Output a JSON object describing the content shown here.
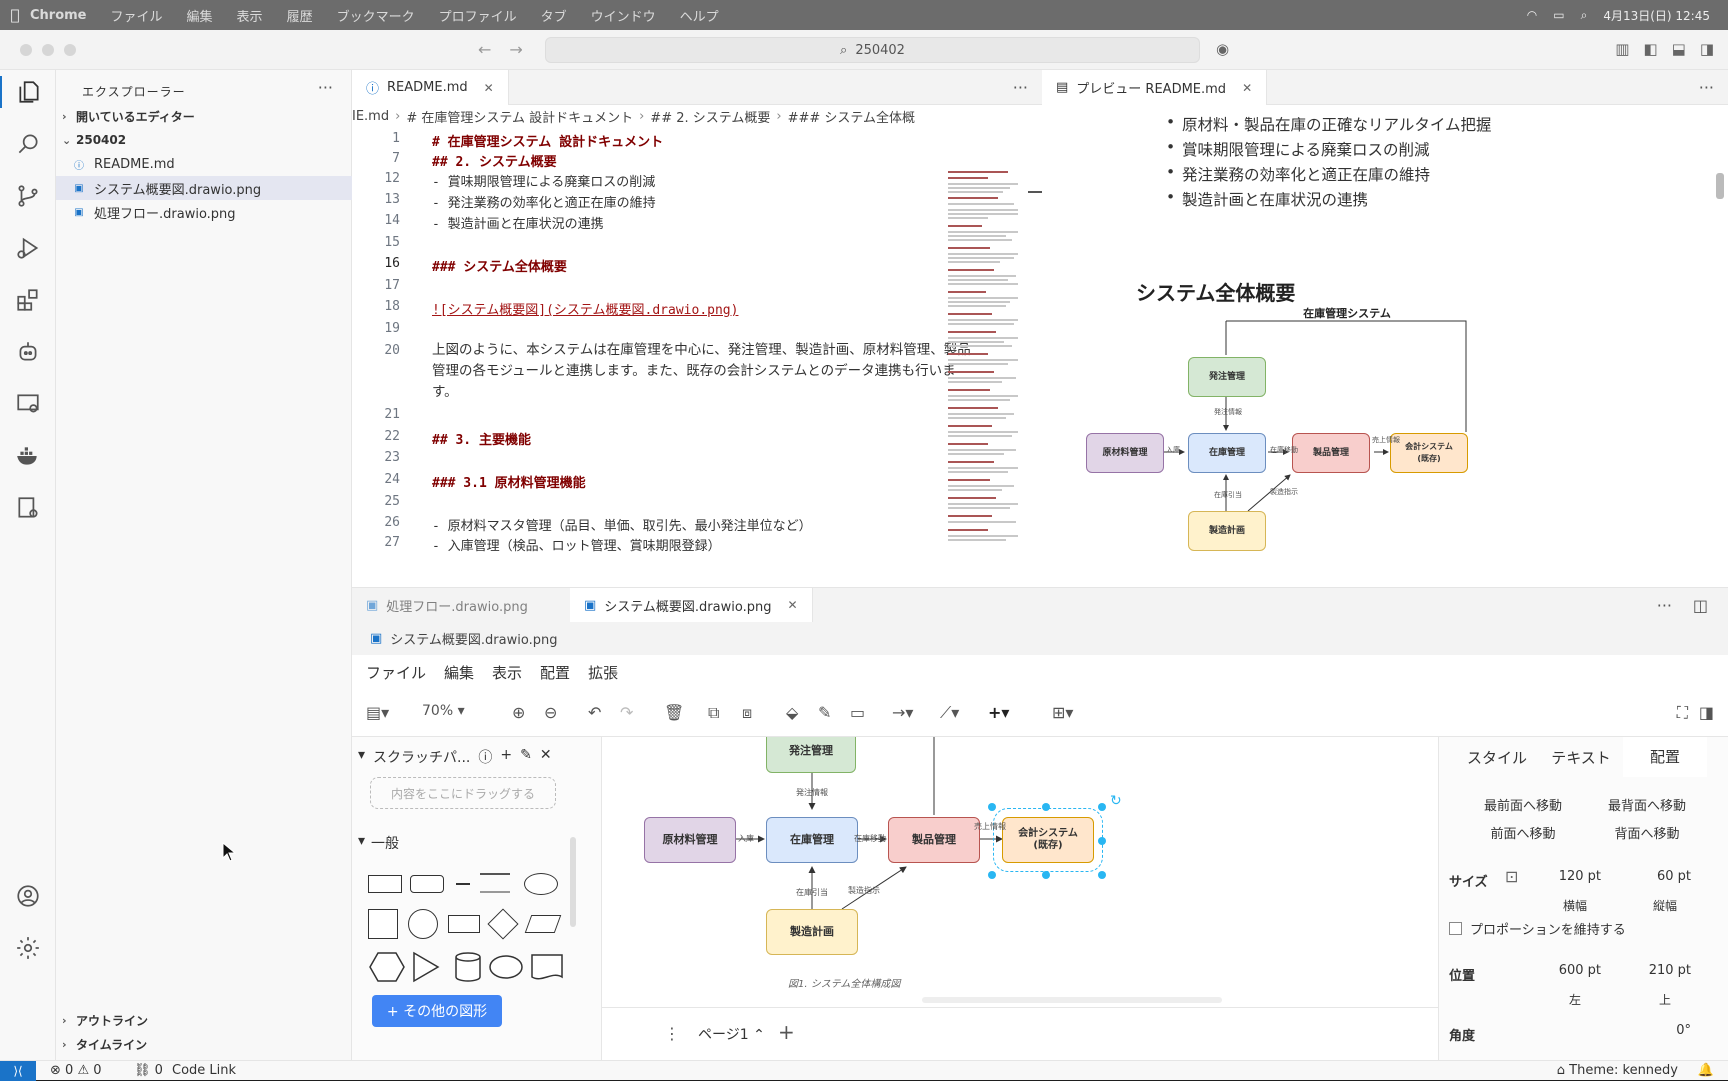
{
  "macmenu": {
    "app": "Chrome",
    "items": [
      "ファイル",
      "編集",
      "表示",
      "履歴",
      "ブックマーク",
      "プロファイル",
      "タブ",
      "ウインドウ",
      "ヘルプ"
    ],
    "clock": "4月13日(日) 12:45"
  },
  "window": {
    "search": "250402"
  },
  "explorer": {
    "header": "エクスプローラー",
    "open_editors": "開いているエディター",
    "folder": "250402",
    "files": [
      "README.md",
      "システム概要図.drawio.png",
      "処理フロー.drawio.png"
    ],
    "outline": "アウトライン",
    "timeline": "タイムライン"
  },
  "editor": {
    "tab": "README.md",
    "breadcrumb": [
      "IE.md",
      "# 在庫管理システム 設計ドキュメント",
      "## 2. システム概要",
      "### システム全体概"
    ],
    "lines": [
      {
        "n": "1",
        "t": "# 在庫管理システム 設計ドキュメント"
      },
      {
        "n": "7",
        "t": "## 2. システム概要"
      },
      {
        "n": "12",
        "t": "- 賞味期限管理による廃棄ロスの削減"
      },
      {
        "n": "13",
        "t": "- 発注業務の効率化と適正在庫の維持"
      },
      {
        "n": "14",
        "t": "- 製造計画と在庫状況の連携"
      },
      {
        "n": "15",
        "t": ""
      },
      {
        "n": "16",
        "t": "### システム全体概要"
      },
      {
        "n": "17",
        "t": ""
      },
      {
        "n": "18",
        "t": "![システム概要図](システム概要図.drawio.png)"
      },
      {
        "n": "19",
        "t": ""
      },
      {
        "n": "20",
        "t": "上図のように、本システムは在庫管理を中心に、発注管理、製造計画、原材料管理、製品管理の各モジュールと連携します。また、既存の会計システムとのデータ連携も行います。"
      },
      {
        "n": "21",
        "t": ""
      },
      {
        "n": "22",
        "t": "## 3. 主要機能"
      },
      {
        "n": "23",
        "t": ""
      },
      {
        "n": "24",
        "t": "### 3.1 原材料管理機能"
      },
      {
        "n": "25",
        "t": ""
      },
      {
        "n": "26",
        "t": "- 原材料マスタ管理（品目、単価、取引先、最小発注単位など）"
      },
      {
        "n": "27",
        "t": "- 入庫管理（検品、ロット管理、賞味期限登録）"
      }
    ]
  },
  "preview": {
    "tab": "プレビュー README.md",
    "bullets": [
      "原材料・製品在庫の正確なリアルタイム把握",
      "賞味期限管理による廃棄ロスの削減",
      "発注業務の効率化と適正在庫の維持",
      "製造計画と在庫状況の連携"
    ],
    "heading": "システム全体概要",
    "diagram_title": "在庫管理システム"
  },
  "diagram": {
    "nodes": {
      "order": "発注管理",
      "raw": "原材料管理",
      "stock": "在庫管理",
      "product": "製品管理",
      "accounting": "会計システム\n(既存)",
      "plan": "製造計画"
    },
    "edges": {
      "order_stock": "発注情報",
      "raw_stock": "入庫",
      "stock_product": "在庫移動",
      "product_acc": "売上情報",
      "plan_stock": "在庫引当",
      "plan_product": "製造指示"
    },
    "caption": "図1. システム全体構成図"
  },
  "panel2": {
    "tabs": [
      "処理フロー.drawio.png",
      "システム概要図.drawio.png"
    ],
    "breadcrumb": "システム概要図.drawio.png"
  },
  "drawio": {
    "menu": [
      "ファイル",
      "編集",
      "表示",
      "配置",
      "拡張"
    ],
    "zoom": "70%",
    "scratchpad": "スクラッチパ...",
    "drop_hint": "内容をここにドラッグする",
    "general": "一般",
    "more_shapes": "+ その他の図形",
    "page": "ページ1",
    "format_tabs": [
      "スタイル",
      "テキスト",
      "配置"
    ],
    "arrange": [
      "最前面へ移動",
      "最背面へ移動",
      "前面へ移動",
      "背面へ移動"
    ],
    "size_label": "サイズ",
    "width": "120 pt",
    "height": "60 pt",
    "width_lbl": "横幅",
    "height_lbl": "縦幅",
    "proportion": "プロポーションを維持する",
    "pos_label": "位置",
    "left": "600 pt",
    "top": "210 pt",
    "left_lbl": "左",
    "top_lbl": "上",
    "angle_label": "角度",
    "angle": "0°"
  },
  "statusbar": {
    "errors": "0",
    "warnings": "0",
    "ports": "0",
    "codelink": "Code Link",
    "theme": "Theme: kennedy"
  },
  "colors": {
    "accent": "#1a73c8",
    "green": "#d5e8d4",
    "blue": "#dae8fc",
    "pink": "#f8cecc",
    "orange": "#ffe6cc",
    "yellow": "#fff2cc",
    "purple": "#e1d5e7"
  }
}
